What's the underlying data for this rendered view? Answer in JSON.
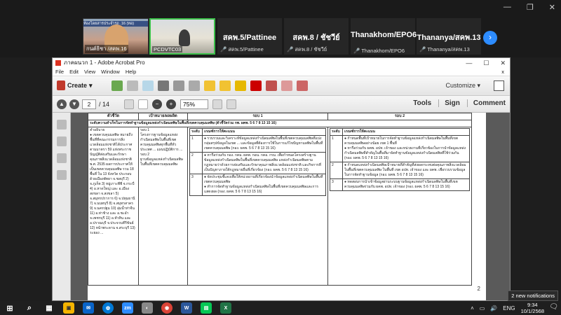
{
  "zoom": {
    "video1": {
      "banner": "ห้องโดยสารประจำรถ .16 (ทอ)",
      "caption": "กนต์ธิชา /สคพ.16"
    },
    "video2": {
      "caption": "PCDVTC03"
    },
    "participants": [
      {
        "name": "สคพ.5/Pattinee",
        "caption": "สคพ.5/Pattinee"
      },
      {
        "name": "สคพ.8 / ชัชวีย์",
        "caption": "สคพ.8 / ชัชวีย์"
      },
      {
        "name": "Thanakhom/EPO6",
        "caption": "Thanakhom/EPO6"
      },
      {
        "name": "Thananya/สคพ.13",
        "caption": "Thananya/สคพ.13"
      }
    ],
    "next_icon": "›",
    "window_buttons": [
      "—",
      "❐",
      "✕"
    ]
  },
  "acrobat": {
    "title": "ภาคผนวก 1 - Adobe Acrobat Pro",
    "window_buttons": [
      "—",
      "☐",
      "✕"
    ],
    "menu": [
      "File",
      "Edit",
      "View",
      "Window",
      "Help"
    ],
    "menu_close": "x",
    "create_label": "Create",
    "customize_label": "Customize",
    "page_current": "2",
    "page_total": "/ 14",
    "zoom_value": "75%",
    "right_links": [
      "Tools",
      "Sign",
      "Comment"
    ]
  },
  "document": {
    "col_indicator": "ตัวชี้วัด",
    "col_target": "เป้าหมาย/ผลผลิต",
    "col_round1": "รอบ 1",
    "col_round2": "รอบ 2",
    "title_row": "ระดับความสำเร็จในการจัดทำฐานข้อมูลแหล่งกำเนิดมลพิษในพื้นที่เขตควบคุมมลพิษ (ตัวชี้วัดร่วม กพ. ผคพ. 5 6 7 8 13 15 16)",
    "indicator_text": "คำอธิบาย\n● เขตควบคุมมลพิษ หมายถึง พื้นที่ที่คณะกรรมการสิ่งแวดล้อมแห่งชาติได้ประกาศตามมาตรา 59 แห่งพระราชบัญญัติส่งเสริมและรักษาคุณภาพสิ่งแวดล้อมแห่งชาติ พ.ศ. 2535 ผลการประกาศให้เป็นเขตควบคุมมลพิษ รวม 18 พื้นที่ ใน 13 จังหวัด ประกอบด้วยเมืองพัทยา จ.ชลบุรี 2) จ.ภูเก็ต 3) หมู่เกาะพีพี จ.กระบี่ 4) อ.หาดใหญ่ และ อ.เมืองสงขลา จ.สงขลา 5) จ.สมุทรปราการ 6) จ.ปทุมธานี 7) จ.นนทบุรี 8) จ.สมุทรสาคร 9) จ.นครปฐม 10) ลุ่มน้ำท่าจีน 11) อ.ท่าช้าง และ อ.ชะอำ จ.เพชรบุรี 11) อ.หัวหิน และ อ.ปราณบุรี จ.ประจวบคีรีขันธ์ 12) หน้าพระลาน จ.สระบุรี 13) ระยอง ...",
    "target_text": "รอบ 1\nโครงการฐานข้อมูลแหล่งกำเนิดมลพิษในพื้นที่เขตควบคุมมลพิษทุกพื้นที่ทั่วประเทศ ... แผนปฏิบัติการ ... รอบ 2\nฐานข้อมูลแหล่งกำเนิดมลพิษในพื้นที่เขตควบคุมมลพิษ",
    "round1_header": [
      "ระดับ",
      "เกณฑ์การให้คะแนน"
    ],
    "round1_rows": [
      {
        "level": "1",
        "text": "● รวบรวมและวิเคราะห์ข้อมูลแหล่งกำเนิดมลพิษในพื้นที่เขตควบคุมมลพิษที่แบ่งกลุ่มสรุปข้อมูลในเขต ... และข้อมูลที่ต้องการใช้ในการแก้ไขปัญหามลพิษในพื้นที่เขตควบคุมมลพิษ (กอง. ผคพ. 5 6 7 8 13 15 16)"
      },
      {
        "level": "2",
        "text": "● หารือร่วมกับ กอง. กคม. ผคพ. กอน. กคอ. กรม. เพื่อกำหนดโครงสร้างฐานข้อมูลแหล่งกำเนิดมลพิษในพื้นที่เขตควบคุมมลพิษ แหล่งกำเนิดมลพิษตามกฎหมายว่าด้วยการส่งเสริมและรักษาคุณภาพสิ่งแวดล้อมแห่งชาติ และกิจการที่เป็นปัญหาภายใต้กฎหมายอื่นที่เกี่ยวข้อง (กอง. ผคพ. 5 6 7 8 13 15 16)"
      },
      {
        "level": "3",
        "text": "● จัดประชุมชี้แจงเพื่อให้หน่วยงานที่เกี่ยวข้องนำข้อมูลแหล่งกำเนิดมลพิษในพื้นที่เขตควบคุมมลพิษ\n● ทำการจัดทำฐานข้อมูลแหล่งกำเนิดมลพิษในพื้นที่เขตควบคุมมลพิษและการแสดงผล (กอง. ผคพ. 5 6 7 8 13 15 16)"
      }
    ],
    "round2_header": [
      "ระดับ",
      "เกณฑ์การให้คะแนน"
    ],
    "round2_rows": [
      {
        "level": "1",
        "text": "● กำหนดพื้นที่เป้าหมายในการจัดทำฐานข้อมูลแหล่งกำเนิดมลพิษในพื้นที่เขตควบคุมมลพิษอย่างน้อย เขต 1 พื้นที่\n● หารือร่วมกับ ผคพ. อปท. เจ้าของ และหน่วยงานที่เกี่ยวข้องในการนำข้อมูลแหล่งกำเนิดมลพิษที่สำคัญในพื้นที่มาจัดทำฐานข้อมูลแหล่งกำเนิดมลพิษที่ใช้ร่วมกัน (กอง. ผคพ. 5 6 7 8 13 15 16)"
      },
      {
        "level": "2",
        "text": "● กำหนดแหล่งกำเนิดมลพิษเป้าหมายที่สำคัญที่ส่งผลกระทบต่อคุณภาพสิ่งแวดล้อมในพื้นที่เขตควบคุมมลพิษ ในพื้นที่ เขต อปท. เจ้าของ และ ผคพ. เพื่อรวบรวมข้อมูลในการจัดทำฐานข้อมูล (กอง. ผคพ. 5 6 7 8 13 15 16)"
      },
      {
        "level": "3",
        "text": "● ทดสอบการนำเข้าข้อมูลผ่านระบบฐานข้อมูลแหล่งกำเนิดมลพิษในพื้นที่เขตควบคุมมลพิษร่วมกับ ผคพ. อปท. เจ้าของ (กอง. ผคพ. 5 6 7 8 13 15 16)"
      }
    ],
    "page_number": "2"
  },
  "taskbar": {
    "apps": [
      "⊞",
      "⌕",
      "▦",
      "▣",
      "✉",
      "◍",
      "zm",
      "◐",
      "◉",
      "W",
      "▤",
      "X"
    ],
    "tray_caret": "˄",
    "language": "ENG",
    "time": "9:34",
    "date": "10/1/2568",
    "toast": "2 new notifications"
  }
}
